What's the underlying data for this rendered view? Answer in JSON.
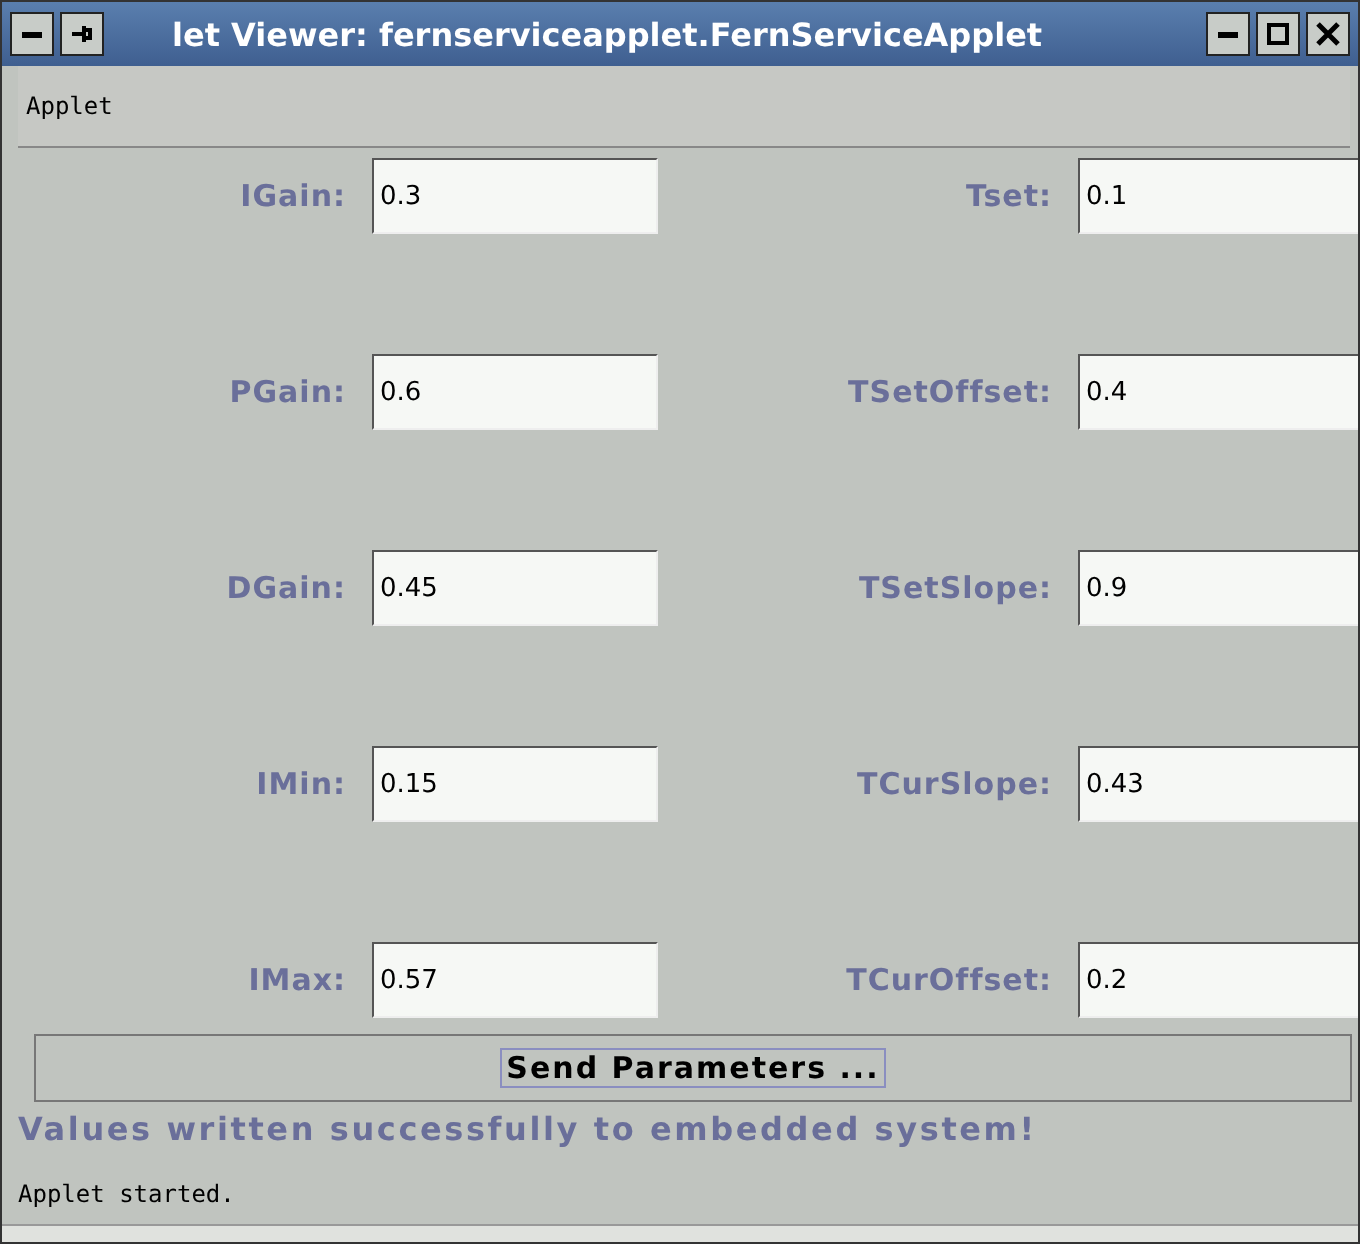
{
  "window": {
    "title": "let Viewer: fernserviceapplet.FernServiceApplet"
  },
  "menu": [
    "Applet"
  ],
  "fields": [
    {
      "label": "IGain:",
      "value": "0.3"
    },
    {
      "label": "Tset:",
      "value": "0.1"
    },
    {
      "label": "PGain:",
      "value": "0.6"
    },
    {
      "label": "TSetOffset:",
      "value": "0.4"
    },
    {
      "label": "DGain:",
      "value": "0.45"
    },
    {
      "label": "TSetSlope:",
      "value": "0.9"
    },
    {
      "label": "IMin:",
      "value": "0.15"
    },
    {
      "label": "TCurSlope:",
      "value": "0.43"
    },
    {
      "label": "IMax:",
      "value": "0.57"
    },
    {
      "label": "TCurOffset:",
      "value": "0.2"
    }
  ],
  "button": "Send Parameters ...",
  "message": "Values written successfully to embedded system!",
  "status_bar": "Applet started."
}
